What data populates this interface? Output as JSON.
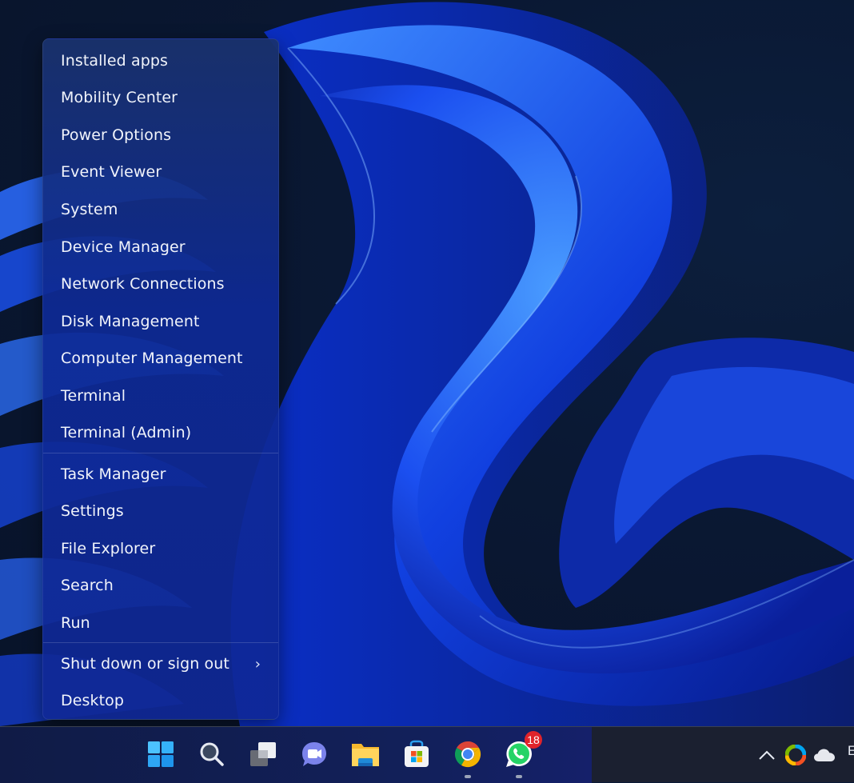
{
  "context_menu": {
    "items": [
      {
        "label": "Installed apps"
      },
      {
        "label": "Mobility Center"
      },
      {
        "label": "Power Options"
      },
      {
        "label": "Event Viewer"
      },
      {
        "label": "System"
      },
      {
        "label": "Device Manager"
      },
      {
        "label": "Network Connections"
      },
      {
        "label": "Disk Management"
      },
      {
        "label": "Computer Management"
      },
      {
        "label": "Terminal"
      },
      {
        "label": "Terminal (Admin)"
      },
      {
        "label": "Task Manager"
      },
      {
        "label": "Settings"
      },
      {
        "label": "File Explorer"
      },
      {
        "label": "Search"
      },
      {
        "label": "Run"
      },
      {
        "label": "Shut down or sign out",
        "submenu_indicator": "›"
      },
      {
        "label": "Desktop"
      }
    ]
  },
  "taskbar": {
    "apps": [
      {
        "name": "Start",
        "icon": "windows-start-icon"
      },
      {
        "name": "Search",
        "icon": "search-icon"
      },
      {
        "name": "Task View",
        "icon": "task-view-icon"
      },
      {
        "name": "Chat",
        "icon": "teams-chat-icon"
      },
      {
        "name": "File Explorer",
        "icon": "file-explorer-icon"
      },
      {
        "name": "Microsoft Store",
        "icon": "store-icon"
      },
      {
        "name": "Google Chrome",
        "icon": "chrome-icon",
        "running": true
      },
      {
        "name": "WhatsApp",
        "icon": "whatsapp-icon",
        "running": true,
        "badge": "18"
      }
    ],
    "tray": {
      "overflow_icon": "chevron-up-icon",
      "icons": [
        "edge-dev-icon",
        "onedrive-icon"
      ],
      "clipped_text": "E"
    }
  },
  "colors": {
    "menu_bg": "#1430a0",
    "menu_text": "#f1f4fb",
    "taskbar_bg": "#1b2030",
    "badge": "#e0232b"
  }
}
